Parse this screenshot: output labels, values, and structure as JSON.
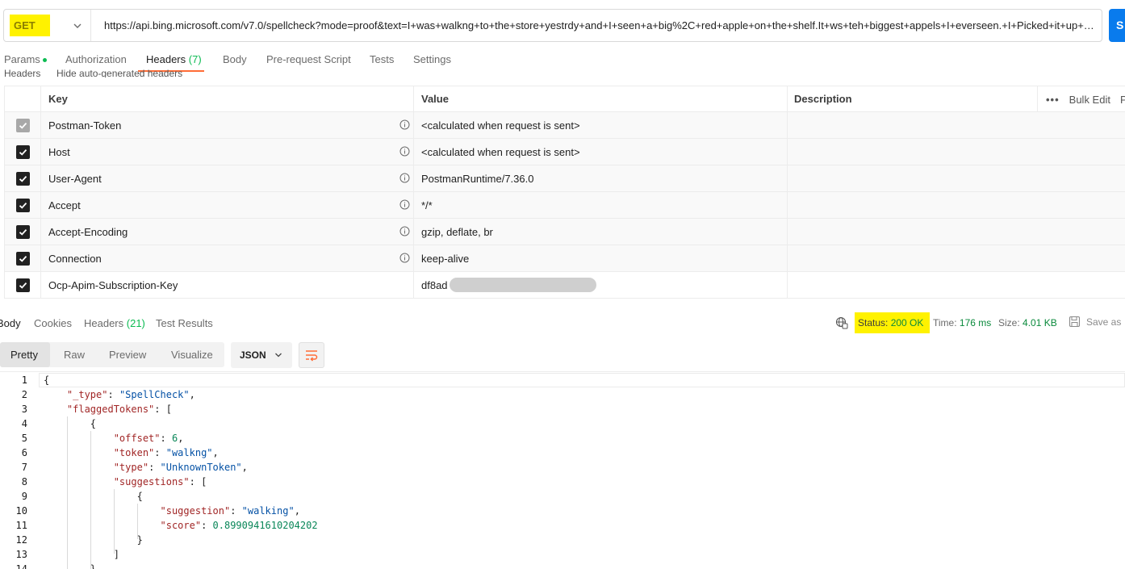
{
  "request": {
    "method": "GET",
    "url": "https://api.bing.microsoft.com/v7.0/spellcheck?mode=proof&text=I+was+walkng+to+the+store+yestrdy+and+I+seen+a+big%2C+red+apple+on+the+shelf.It+ws+teh+biggest+appels+I+everseen.+I+Picked+it+up+and...",
    "send_label": "S"
  },
  "req_tabs": {
    "params": "Params",
    "authorization": "Authorization",
    "headers": "Headers",
    "headers_count": "(7)",
    "body": "Body",
    "pre_request": "Pre-request Script",
    "tests": "Tests",
    "settings": "Settings"
  },
  "headers_section": {
    "peek_label": "Headers",
    "hide_auto": "Hide auto-generated headers"
  },
  "headers_table": {
    "columns": {
      "key": "Key",
      "value": "Value",
      "description": "Description"
    },
    "bulk_edit": "Bulk Edit",
    "presets": "P",
    "more": "•••",
    "rows": [
      {
        "key": "Postman-Token",
        "value": "<calculated when request is sent>",
        "checked": true,
        "auto": true
      },
      {
        "key": "Host",
        "value": "<calculated when request is sent>",
        "checked": true,
        "auto": true
      },
      {
        "key": "User-Agent",
        "value": "PostmanRuntime/7.36.0",
        "checked": true,
        "auto": true
      },
      {
        "key": "Accept",
        "value": "*/*",
        "checked": true,
        "auto": true
      },
      {
        "key": "Accept-Encoding",
        "value": "gzip, deflate, br",
        "checked": true,
        "auto": true
      },
      {
        "key": "Connection",
        "value": "keep-alive",
        "checked": true,
        "auto": true
      },
      {
        "key": "Ocp-Apim-Subscription-Key",
        "value": "df8ad",
        "checked": true,
        "auto": false
      }
    ]
  },
  "response": {
    "tabs": {
      "body": "Body",
      "cookies": "Cookies",
      "headers": "Headers",
      "headers_count": "(21)",
      "test_results": "Test Results"
    },
    "status_label": "Status:",
    "status_value": "200 OK",
    "time_label": "Time:",
    "time_value": "176 ms",
    "size_label": "Size:",
    "size_value": "4.01 KB",
    "save_as": "Save as"
  },
  "format": {
    "pretty": "Pretty",
    "raw": "Raw",
    "preview": "Preview",
    "visualize": "Visualize",
    "language": "JSON"
  },
  "code_lines": [
    {
      "n": "1",
      "text": "{"
    },
    {
      "n": "2",
      "text": "    \"_type\": \"SpellCheck\","
    },
    {
      "n": "3",
      "text": "    \"flaggedTokens\": ["
    },
    {
      "n": "4",
      "text": "        {"
    },
    {
      "n": "5",
      "text": "            \"offset\": 6,"
    },
    {
      "n": "6",
      "text": "            \"token\": \"walkng\","
    },
    {
      "n": "7",
      "text": "            \"type\": \"UnknownToken\","
    },
    {
      "n": "8",
      "text": "            \"suggestions\": ["
    },
    {
      "n": "9",
      "text": "                {"
    },
    {
      "n": "10",
      "text": "                    \"suggestion\": \"walking\","
    },
    {
      "n": "11",
      "text": "                    \"score\": 0.8990941610204202"
    },
    {
      "n": "12",
      "text": "                }"
    },
    {
      "n": "13",
      "text": "            ]"
    },
    {
      "n": "14",
      "text": "        },"
    }
  ],
  "colors": {
    "highlight": "#fff200",
    "accent": "#ff6c37",
    "success": "#0cbb52",
    "send": "#097bed"
  }
}
